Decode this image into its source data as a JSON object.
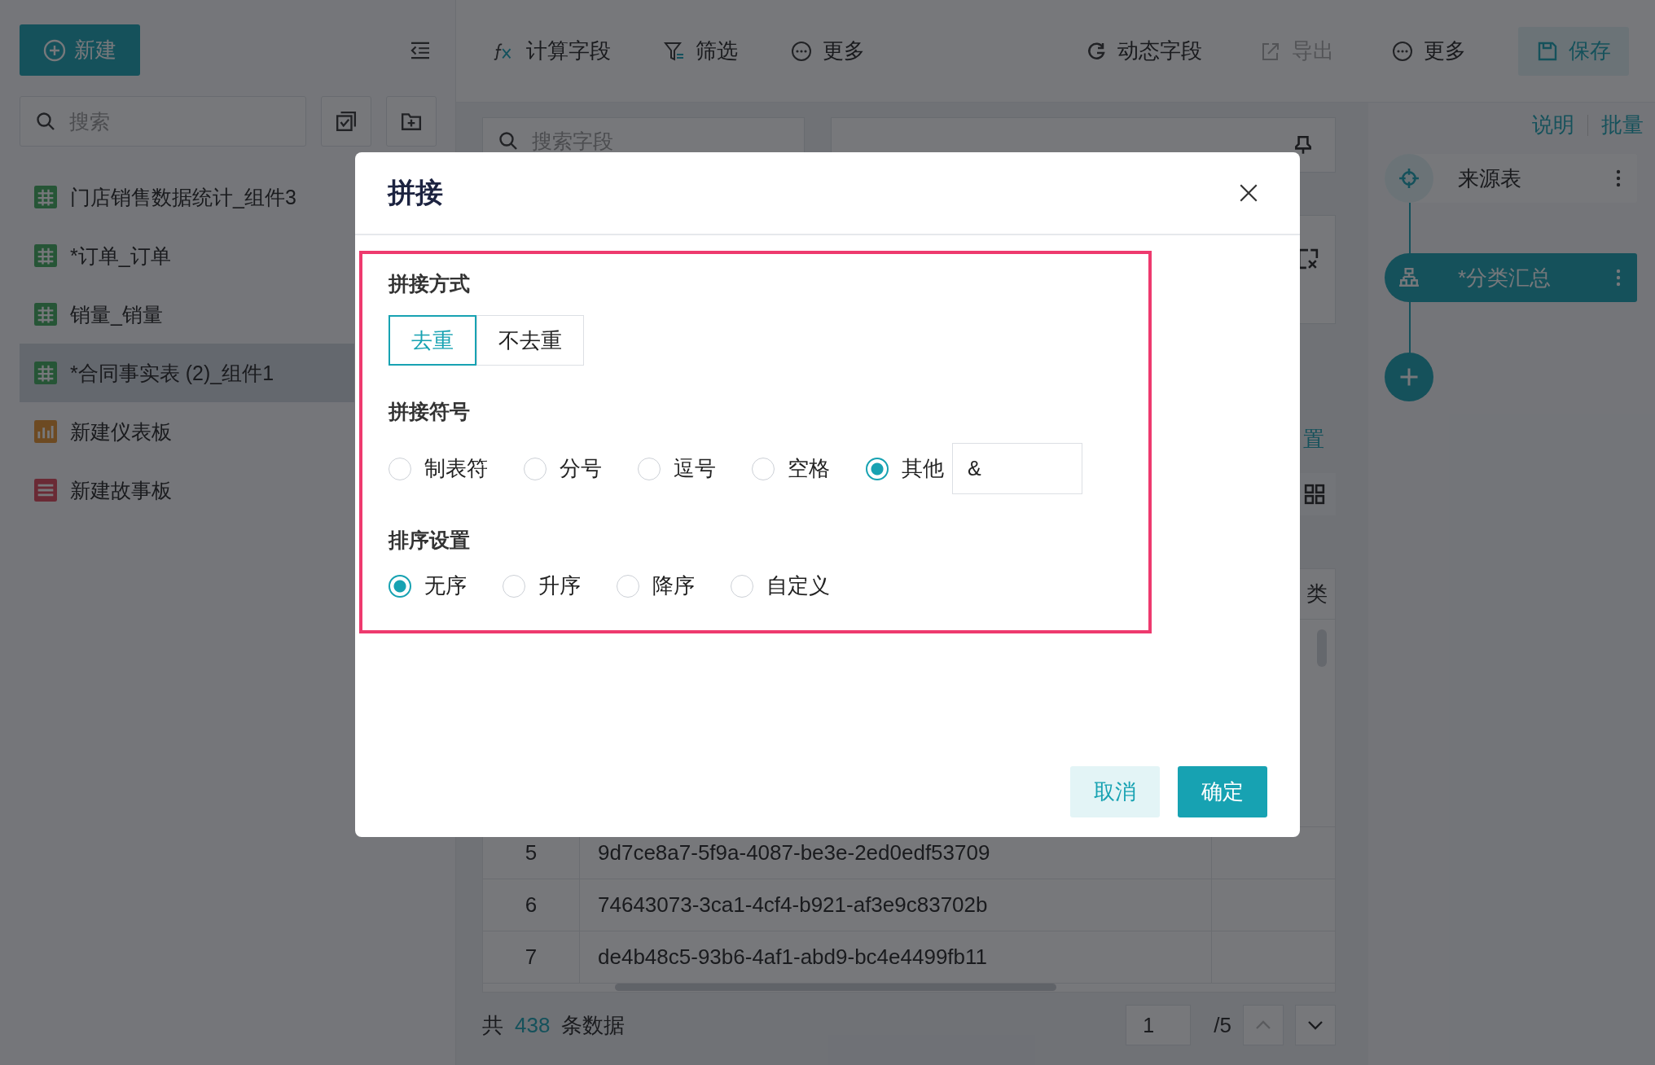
{
  "sidebar": {
    "new_button": "新建",
    "search": {
      "placeholder": "搜索"
    },
    "items": [
      {
        "label": "门店销售数据统计_组件3",
        "kind": "table",
        "selected": false
      },
      {
        "label": "*订单_订单",
        "kind": "table",
        "selected": false
      },
      {
        "label": "销量_销量",
        "kind": "table",
        "selected": false
      },
      {
        "label": "*合同事实表 (2)_组件1",
        "kind": "table",
        "selected": true
      },
      {
        "label": "新建仪表板",
        "kind": "dashboard",
        "selected": false
      },
      {
        "label": "新建故事板",
        "kind": "story",
        "selected": false
      }
    ]
  },
  "toolbar": {
    "left": [
      {
        "label": "计算字段",
        "kind": "formula",
        "disabled": false
      },
      {
        "label": "筛选",
        "kind": "filter",
        "disabled": false
      },
      {
        "label": "更多",
        "kind": "more",
        "disabled": false
      }
    ],
    "right": [
      {
        "label": "动态字段",
        "kind": "dynamic",
        "disabled": false
      },
      {
        "label": "导出",
        "kind": "export",
        "disabled": true
      },
      {
        "label": "更多",
        "kind": "more",
        "disabled": false
      },
      {
        "label": "保存",
        "kind": "save",
        "disabled": false
      }
    ]
  },
  "field_panel": {
    "search": {
      "placeholder": "搜索字段"
    }
  },
  "config": {
    "link_fragment": "置"
  },
  "table": {
    "column_3": "类",
    "rows": [
      {
        "index": "5",
        "value": "9d7ce8a7-5f9a-4087-be3e-2ed0edf53709"
      },
      {
        "index": "6",
        "value": "74643073-3ca1-4cf4-b921-af3e9c83702b"
      },
      {
        "index": "7",
        "value": "de4b48c5-93b6-4af1-abd9-bc4e4499fb11"
      }
    ]
  },
  "footer": {
    "prefix": "共",
    "count": "438",
    "suffix": "条数据",
    "page": "1",
    "total_pages": "/5",
    "prev_disabled": true
  },
  "flow": {
    "links": [
      "说明",
      "批量"
    ],
    "nodes": [
      {
        "label": "来源表",
        "kind": "source",
        "selected": false
      },
      {
        "label": "*分类汇总",
        "kind": "summary",
        "selected": true
      }
    ]
  },
  "dialog": {
    "title": "拼接",
    "sections": [
      {
        "label": "拼接方式",
        "kind": "segmented",
        "options": [
          {
            "label": "去重",
            "selected": true
          },
          {
            "label": "不去重",
            "selected": false
          }
        ]
      },
      {
        "label": "拼接符号",
        "kind": "radio",
        "options": [
          {
            "label": "制表符",
            "selected": false
          },
          {
            "label": "分号",
            "selected": false
          },
          {
            "label": "逗号",
            "selected": false
          },
          {
            "label": "空格",
            "selected": false
          },
          {
            "label": "其他",
            "selected": true
          }
        ],
        "custom_value": "&"
      },
      {
        "label": "排序设置",
        "kind": "radio",
        "options": [
          {
            "label": "无序",
            "selected": true
          },
          {
            "label": "升序",
            "selected": false
          },
          {
            "label": "降序",
            "selected": false
          },
          {
            "label": "自定义",
            "selected": false
          }
        ]
      }
    ],
    "buttons": [
      {
        "label": "取消",
        "kind": "secondary"
      },
      {
        "label": "确定",
        "kind": "primary"
      }
    ]
  }
}
